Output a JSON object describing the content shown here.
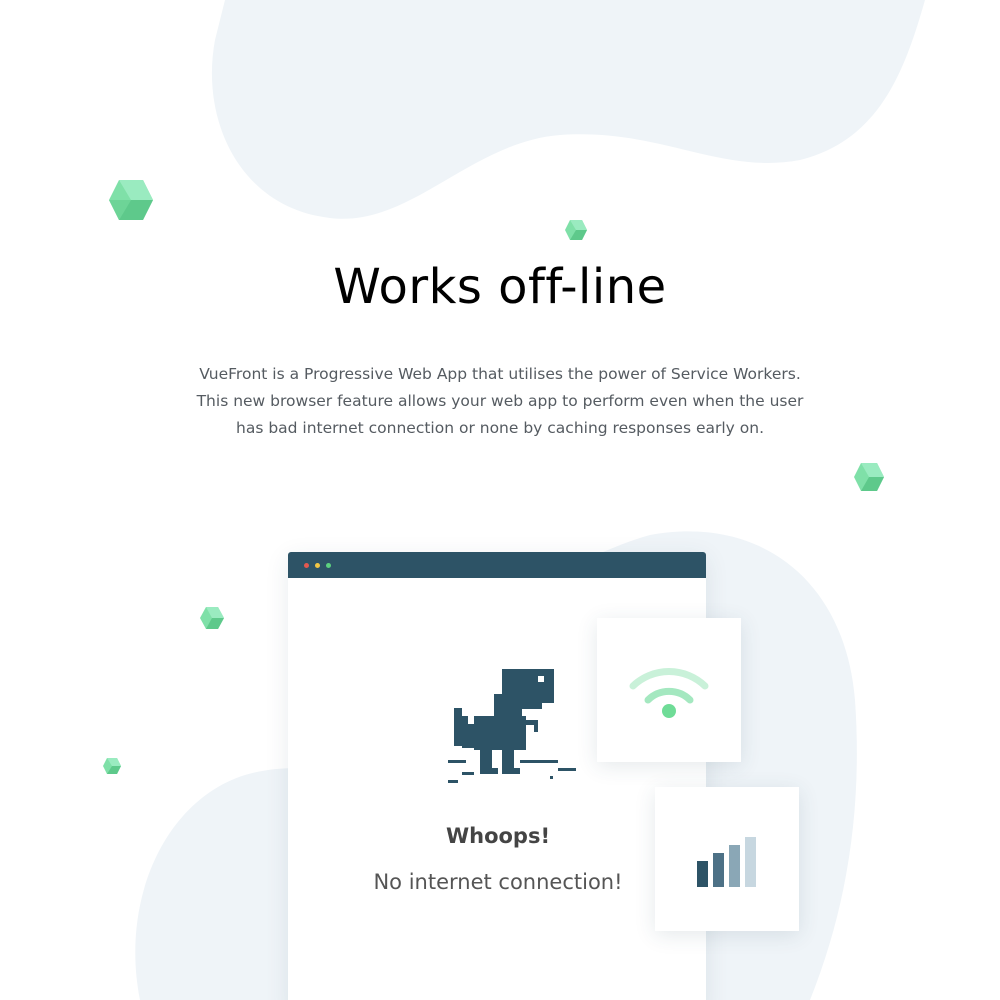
{
  "section": {
    "title": "Works off-line",
    "description_lines": [
      "VueFront is a Progressive Web App that utilises the power of Service Workers.",
      "This new browser feature allows your web app to perform even when the user",
      "has bad internet connection or none by caching responses early on."
    ]
  },
  "browser_mockup": {
    "window_controls": [
      "close",
      "minimize",
      "maximize"
    ],
    "illustration": "offline-dinosaur",
    "heading": "Whoops!",
    "message": "No internet connection!"
  },
  "cards": [
    {
      "icon": "wifi-icon"
    },
    {
      "icon": "signal-bars-icon"
    }
  ],
  "colors": {
    "accent_green": "#6fdc97",
    "browser_bar": "#2d5366",
    "blob_background": "#eff4f8",
    "signal_bar_dark": "#2d5366",
    "signal_bar_mid": "#6f8fa0",
    "signal_bar_light": "#c7d7e0"
  }
}
